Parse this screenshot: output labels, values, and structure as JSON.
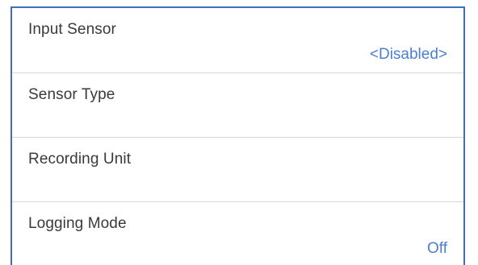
{
  "settings": {
    "rows": [
      {
        "label": "Input Sensor",
        "value": "<Disabled>"
      },
      {
        "label": "Sensor Type",
        "value": ""
      },
      {
        "label": "Recording Unit",
        "value": ""
      },
      {
        "label": "Logging Mode",
        "value": "Off"
      }
    ]
  },
  "colors": {
    "border": "#3f6ebd",
    "value_text": "#4a7fd0",
    "label_text": "#3a3a3a",
    "divider": "#d7d7d7"
  }
}
